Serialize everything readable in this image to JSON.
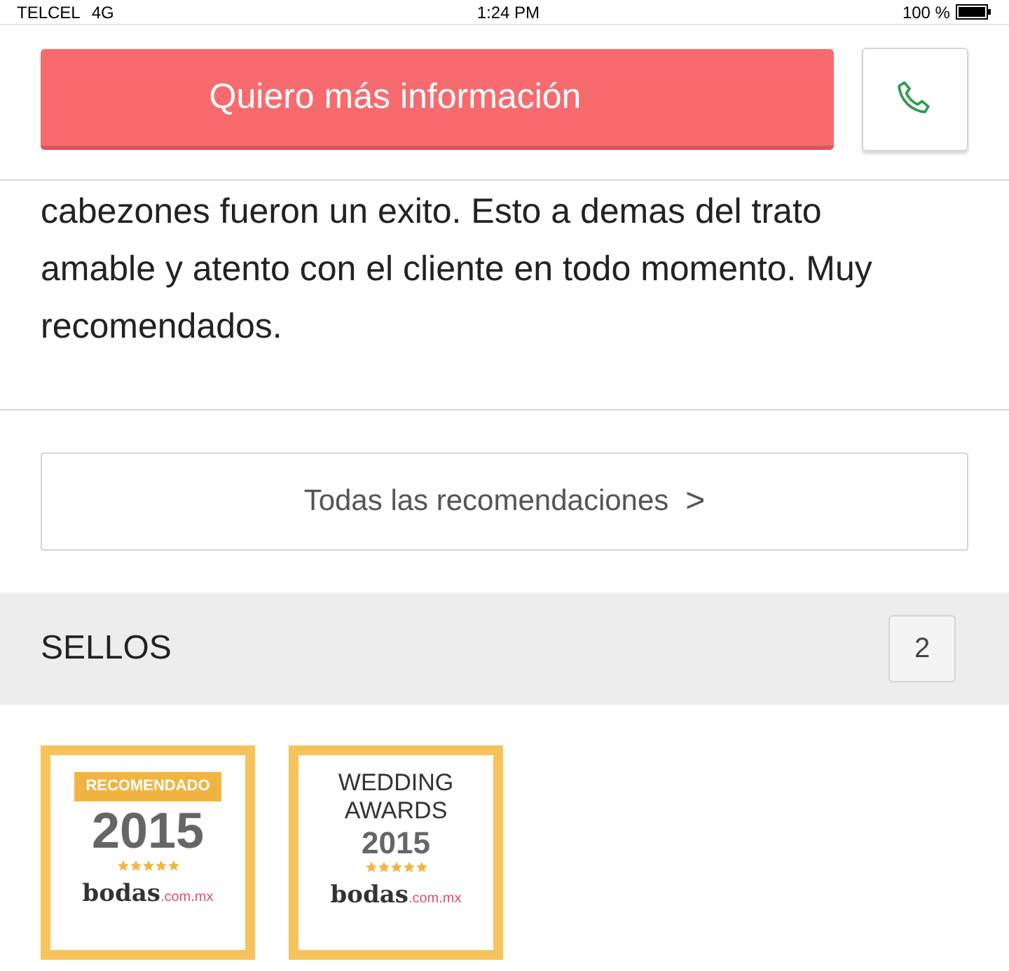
{
  "status_bar": {
    "carrier": "TELCEL",
    "network": "4G",
    "time": "1:24 PM",
    "battery": "100 %"
  },
  "header": {
    "cta": "Quiero más información"
  },
  "review": {
    "text_lines": [
      "cabezones fueron un exito. Esto a demas del trato",
      "amable y atento con el cliente en todo momento. Muy",
      "recomendados."
    ]
  },
  "all_recommendations": {
    "label": "Todas las recomendaciones",
    "chevron": ">"
  },
  "seals": {
    "title": "SELLOS",
    "count": "2",
    "badges": [
      {
        "kind": "ribbon",
        "lines": [
          "RECOMENDADO"
        ],
        "year": "2015",
        "stars": 5,
        "brand": "bodas",
        "domain": ".com.mx"
      },
      {
        "kind": "plain",
        "lines": [
          "WEDDING",
          "AWARDS"
        ],
        "year": "2015",
        "stars": 5,
        "brand": "bodas",
        "domain": ".com.mx"
      }
    ]
  }
}
